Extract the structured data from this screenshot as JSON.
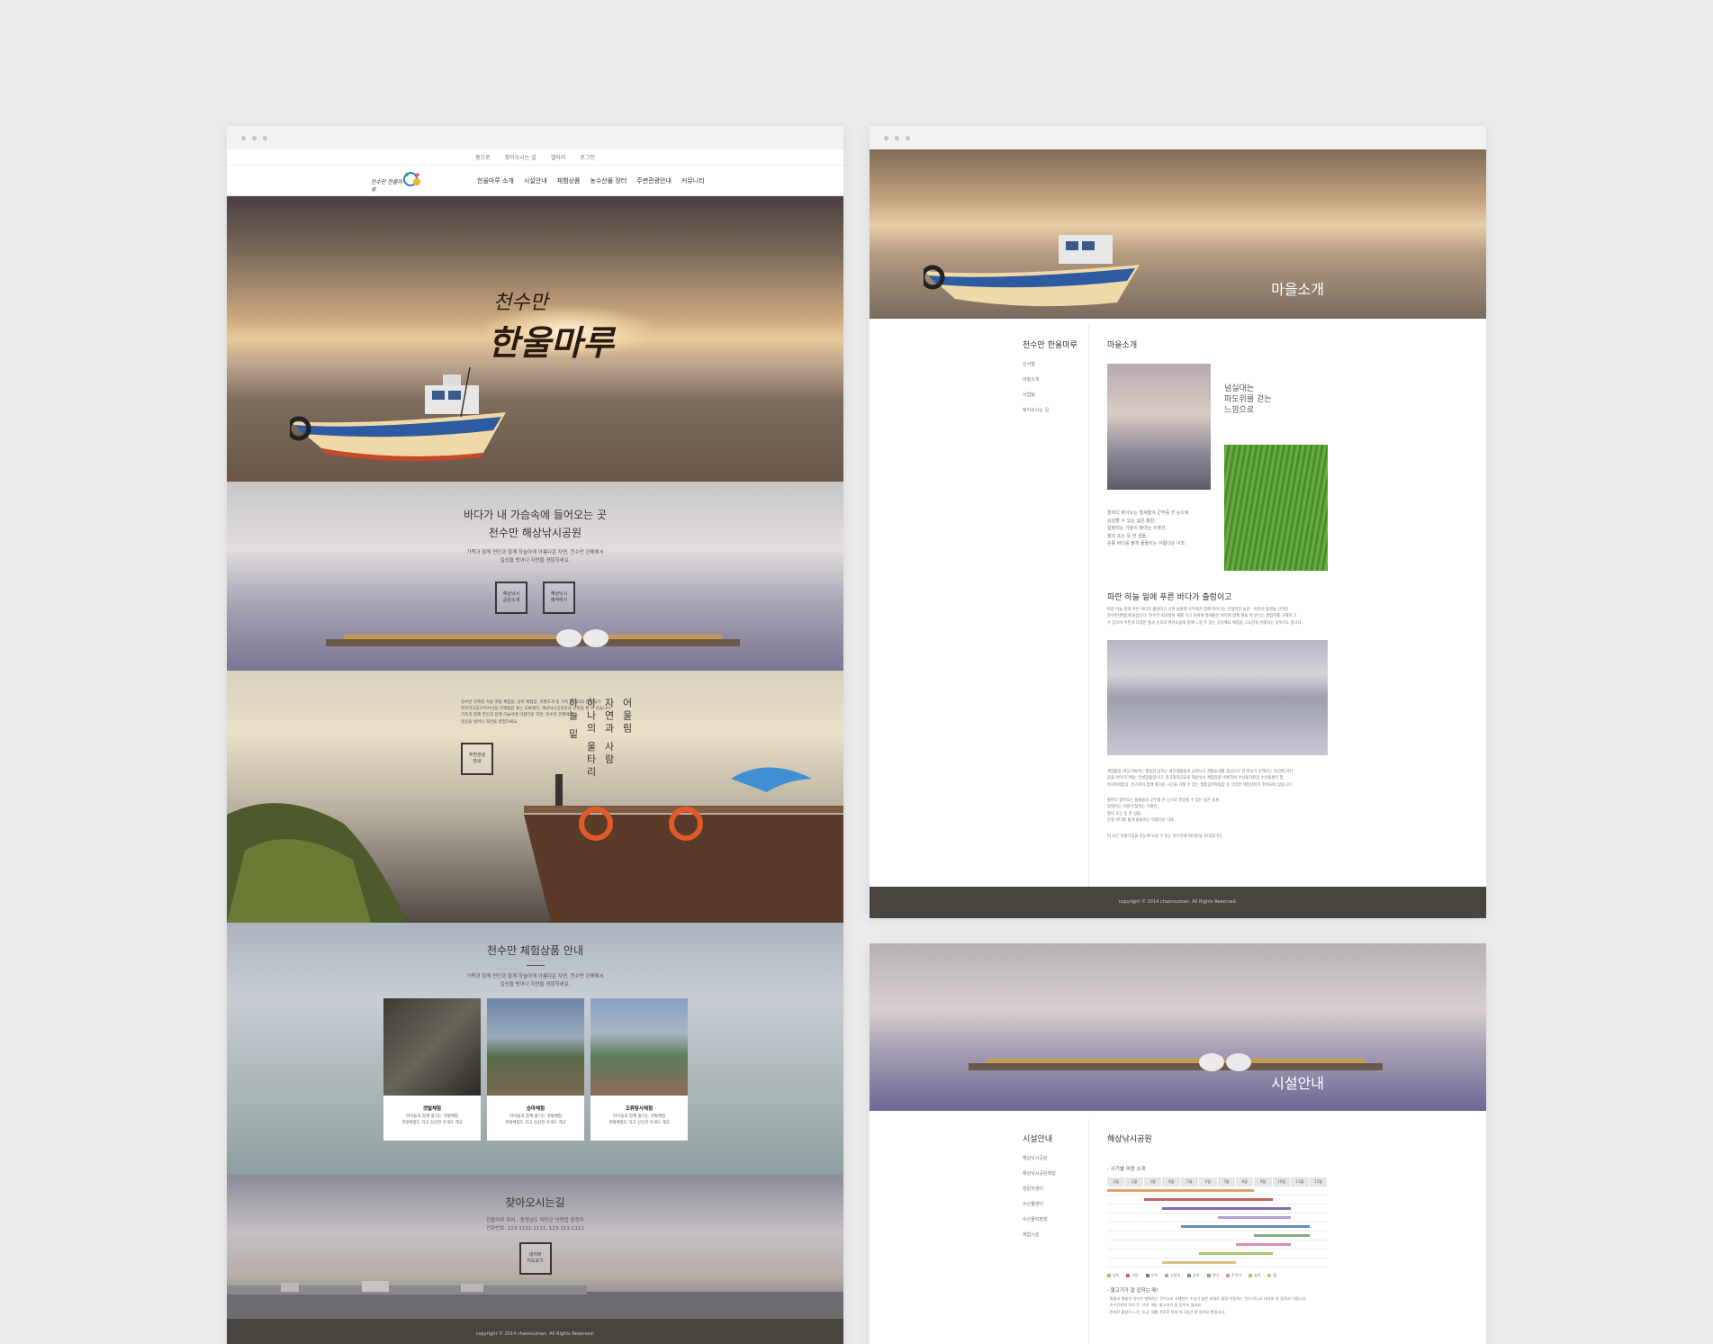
{
  "left_site": {
    "util_links": [
      "홈으로",
      "찾아오시는 길",
      "갤러리",
      "로그인"
    ],
    "logo_text": "천수만 한울마루",
    "menu": [
      "한울마루 소개",
      "시설안내",
      "체험상품",
      "농수산물 장터",
      "주변관광안내",
      "커뮤니티"
    ],
    "hero_calligraphy_line1": "천수만",
    "hero_calligraphy_line2": "한울마루",
    "sec2_title_line1": "바다가 내 가슴속에 들어오는 곳",
    "sec2_title_line2": "천수만 해상낚시공원",
    "sec2_desc_line1": "가족과 함께 연인과 함께 하늘아래 아름다운 자연, 천수만 관해에서",
    "sec2_desc_line2": "일상을 벗어나 자연을 경험하세요.",
    "sec2_btn1_line1": "해상낚시",
    "sec2_btn1_line2": "공원소개",
    "sec2_btn2_line1": "해상낚시",
    "sec2_btn2_line2": "예약하기",
    "sec3_vertical": [
      "어울림",
      "자연과 사람",
      "하나의 울타리",
      "하늘 밑"
    ],
    "sec3_desc_line1": "천수만 관해권 속을 갯벌 체험장, 승마 체험장, 갯벌조개 등 가족 놀거리와 관광지가",
    "sec3_desc_line2": "위치하고있으며서산을 한해협잠 표는 교류센터, 해상낚시공원등을 운영을 할 수 있습니다.",
    "sec3_desc_line3": "가족과 함께 연인과 함께 하늘아래 아름다운 자연, 천수만 관해에서",
    "sec3_desc_line4": "일상을 벗어나 자연을 경험하세요.",
    "sec3_btn_line1": "주변관광",
    "sec3_btn_line2": "안내",
    "sec4_title": "천수만 체험상품 안내",
    "sec4_desc_line1": "가족과 함께 연인과 함께 하늘아래 아름다운 자연, 천수만 관해에서",
    "sec4_desc_line2": "일상을 벗어나 자연을 경험하세요.",
    "cards": [
      {
        "title": "갯벌체험",
        "desc1": "아이들과 함께 즐기는 갯벌체험",
        "desc2": "갯벌체험도 하고 싱싱한 조개도 캐고"
      },
      {
        "title": "승마체험",
        "desc1": "아이들과 함께 즐기는 갯벌체험",
        "desc2": "갯벌체험도 하고 싱싱한 조개도 캐고"
      },
      {
        "title": "조류탐사체험",
        "desc1": "아이들과 함께 즐기는 갯벌체험",
        "desc2": "갯벌체험도 하고 싱싱한 조개도 캐고"
      }
    ],
    "sec5_title": "찾아오시는길",
    "sec5_addr_line1": "한울마루 위치 : 충청남도 태안군 안면읍 중장리",
    "sec5_addr_line2": "전화번호: 123-1111-1111, 123-111-1111",
    "sec5_btn_line1": "네이버",
    "sec5_btn_line2": "지도보기",
    "footer": "copyright © 2014 cheonsuman. All Rights Reserved."
  },
  "right_top": {
    "hero_label": "마을소개",
    "snb_title": "천수만 한울마루",
    "snb_items": [
      "인사말",
      "마을소개",
      "사업팀",
      "찾아오시는 길"
    ],
    "content_title": "마을소개",
    "quote_line1": "넘실대는",
    "quote_line2": "파도위를 걷는",
    "quote_line3": "느낌으로",
    "para1_line1": "철마다 찾아오는 철새들의 군무를 한 눈으로",
    "para1_line2": "감상할 수 있는 넓은 들판,",
    "para1_line3": "일렁이는 가을이 찾아는 수평선,",
    "para1_line4": "철의 조는 듯 한 섬들,",
    "para1_line5": "온종 바다를 붉게 물들이는 아름다운 낙조.",
    "section2_title": "파란 하늘 밑에 푸른 바다가 출렁이고",
    "para2_line1": "파란 하늘 밑에 푸른 바다가 출렁이고 나면 들판엔 모두에가 함께 익어가는 전형적인 농촌 · 어촌의 풍경을 간직한",
    "para2_line2": "천수만(西島)마을입니다. 천수만 422명이 채를 가고 조류에 철새들은 바다와 함께 벌을 며 만나는 경험처를 고해와 고",
    "para2_line3": "수 있으며 어촌과 다양한 펼과 순조의 여유로움에 함께 느낄 수 있는 곳이에요 체험을 고소한과 천해지는 곳이기도 합니다.",
    "para3_line1": "체험활동 바닷가에서는 생동감 넘치는 바다생물들이 넘쳐나고 갯벌조개를 중심으로 한 바닷가 산책로는 일산에 지친",
    "para3_line2": "몸을 쉬어가기에는 안성맞춤입니다. 한국최대규모의 해상낚시 체험장을 비롯하여 수산물직판장 수산물센터 및",
    "para3_line3": "바지락체험장, 온가족이 함께 즐거운 시간을 가질 수 있는 생활공유화협장 등 다양한 체험센터가 준비되어 있습니다.",
    "para4_line1": "철마다 찾아오는 철새들의 군무를 한 눈으로 감상할 수 있는 넓은 들판,",
    "para4_line2": "일렁이는 가을이 찾아는 수평선,",
    "para4_line3": "철의 조는 듯 한 섬들,",
    "para4_line4": "온종 바다를 붉게 물들이는 아름다운 낙조.",
    "para5": "이 모든 아름다움을 한눈에 보실 수 있는 천수만에 여러분을 초대합니다.",
    "footer": "copyright © 2014 cheonsuman. All Rights Reserved."
  },
  "right_bottom": {
    "hero_label": "시설안내",
    "snb_title": "시설안내",
    "snb_items": [
      "해상낚시공원",
      "해상낚시공원체험",
      "방문자센터",
      "수산물센터",
      "수산물직판장",
      "체험시설"
    ],
    "content_title": "해상낚시공원",
    "gantt_heading": "- 시기별 어종 소개",
    "months": [
      "1월",
      "2월",
      "3월",
      "4월",
      "5월",
      "6월",
      "7월",
      "8월",
      "9월",
      "10월",
      "11월",
      "12월"
    ],
    "legend": [
      "넙치",
      "고등",
      "우럭",
      "고등어",
      "농어",
      "전어",
      "주꾸미",
      "숭어",
      "돔"
    ],
    "tips_heading": "- 물고기가 잘 잡히는 때!",
    "tips_line1": "· 밀물과 썰물의 차이가 변화하는 것이나라 사례만은 수상기 낮은 포탈로 물량 이동하는 것이 아니고 바다와 잘 잡혀서 이됩니다.",
    "tips_line2": "· 조수간만의 차가 큰 '사리' 때는 물고기가 잘 잡히지 않아요.",
    "tips_line3": "· 반대로 물살이 느린 '조금' 때를 전후로 하여 약 3일간 잘 잡혀요 편합니다."
  },
  "colors": {
    "background": "#ebebeb",
    "footer": "#4a443f",
    "gantt_colors": [
      "#e0a36b",
      "#c96060",
      "#8a6ab0",
      "#b3a0d4",
      "#6a8ab8",
      "#7fb07a",
      "#d88fb0",
      "#a4c86a",
      "#e0c080"
    ]
  }
}
